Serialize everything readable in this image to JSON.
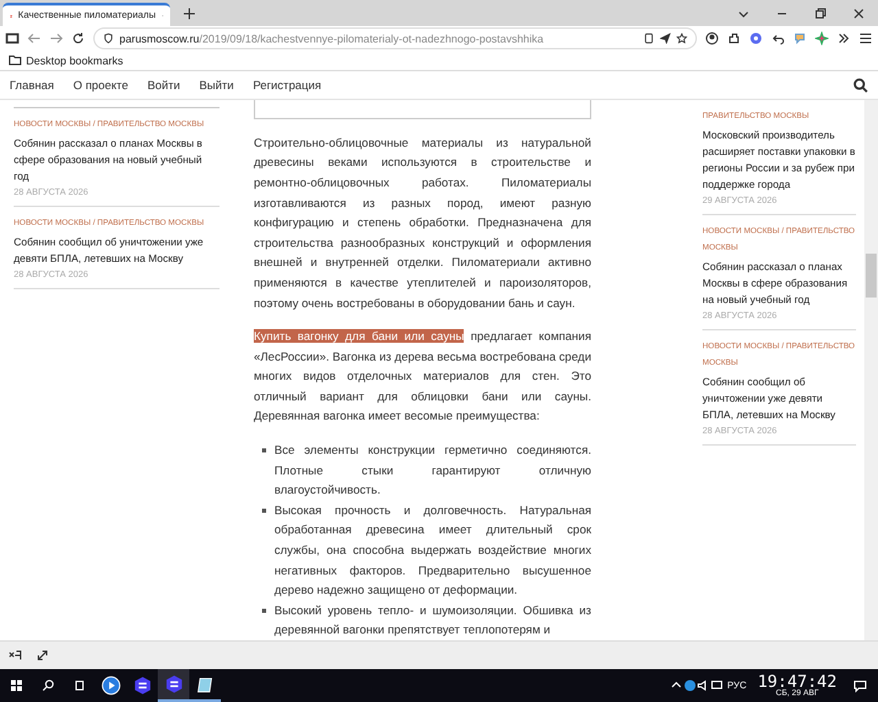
{
  "browser": {
    "tab_title": "Качественные пиломатериалы",
    "url_domain": "parusmoscow.ru",
    "url_path": "/2019/09/18/kachestvennye-pilomaterialy-ot-nadezhnogo-postavshhika",
    "bookmarks": [
      "Desktop bookmarks"
    ]
  },
  "site_nav": {
    "items": [
      "Главная",
      "О проекте",
      "Войти",
      "Выйти",
      "Регистрация"
    ]
  },
  "left_news": [
    {
      "category": "НОВОСТИ МОСКВЫ / ПРАВИТЕЛЬСТВО МОСКВЫ",
      "title": "Собянин рассказал о планах Москвы в сфере образования на новый учебный год",
      "date": "28 АВГУСТА 2026"
    },
    {
      "category": "НОВОСТИ МОСКВЫ / ПРАВИТЕЛЬСТВО МОСКВЫ",
      "title": "Собянин сообщил об уничтожении уже девяти БПЛА, летевших на Москву",
      "date": "28 АВГУСТА 2026"
    }
  ],
  "article": {
    "paragraphs": [
      {
        "text": "Строительно-облицовочные материалы из натуральной древесины веками используются в строительстве и ремонтно-облицовочных работах. Пиломатериалы изготавливаются из разных пород, имеют разную конфигурацию и степень обработки. Предназначена для строительства разнообразных конструкций и оформления внешней и внутренней отделки. Пиломатериали активно применяются в качестве утеплителей и пароизоляторов, поэтому очень востребованы в оборудовании бань и саун."
      },
      {
        "link": "Купить вагонку для бани или сауны",
        "text": " предлагает компания «ЛесРоссии». Вагонка из дерева весьма востребована среди многих видов отделочных материалов для стен. Это отличный вариант для облицовки бани или сауны. Деревянная вагонка имеет весомые преимущества:"
      }
    ],
    "bullets": [
      "Все элементы конструкции герметично соединяются. Плотные стыки гарантируют отличную влагоустойчивость.",
      "Высокая прочность и долговечность. Натуральная обработанная древесина имеет длительный срок службы, она способна выдержать воздействие многих негативных факторов. Предварительно высушенное дерево надежно защищено от деформации.",
      "Высокий уровень тепло- и шумоизоляции. Обшивка из деревянной вагонки препятствует теплопотерям и"
    ]
  },
  "right_news": [
    {
      "category": "ПРАВИТЕЛЬСТВО МОСКВЫ",
      "title": "Московский производитель расширяет поставки упаковки в регионы России и за рубеж при поддержке города",
      "date": "29 АВГУСТА 2026"
    },
    {
      "category": "НОВОСТИ МОСКВЫ / ПРАВИТЕЛЬСТВО МОСКВЫ",
      "title": "Собянин рассказал о планах Москвы в сфере образования на новый учебный год",
      "date": "28 АВГУСТА 2026"
    },
    {
      "category": "НОВОСТИ МОСКВЫ / ПРАВИТЕЛЬСТВО МОСКВЫ",
      "title": "Собянин сообщил об уничтожении уже девяти БПЛА, летевших на Москву",
      "date": "28 АВГУСТА 2026"
    }
  ],
  "taskbar": {
    "language": "РУС",
    "time": "19:47:42",
    "date": "СБ, 29 АВГ"
  }
}
